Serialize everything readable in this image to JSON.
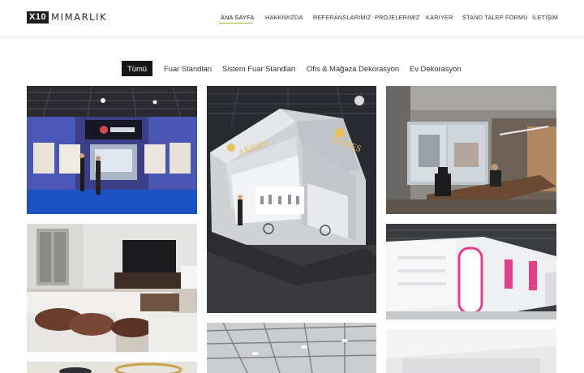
{
  "brand": {
    "logo_mark": "X10",
    "logo_text": "MIMARLIK"
  },
  "nav": {
    "items": [
      {
        "label": "ANA SAYFA",
        "active": true
      },
      {
        "label": "HAKKIMIZDA"
      },
      {
        "label": "REFERANSLARIMIZ"
      },
      {
        "label": "PROJELERIMIZ"
      },
      {
        "label": "KARIYER"
      },
      {
        "label": "STAND TALEP FORMU"
      },
      {
        "label": "İLETİŞİM"
      }
    ],
    "active_color": "#8bc34a"
  },
  "filters": {
    "items": [
      {
        "label": "Tümü",
        "active": true
      },
      {
        "label": "Fuar Standları"
      },
      {
        "label": "Sistem Fuar Standları"
      },
      {
        "label": "Ofis & Mağaza Dekorasyon"
      },
      {
        "label": "Ev Dekorasyon"
      }
    ],
    "active_bg": "#161616"
  },
  "gallery": {
    "booth_sign": "ARBIES"
  }
}
